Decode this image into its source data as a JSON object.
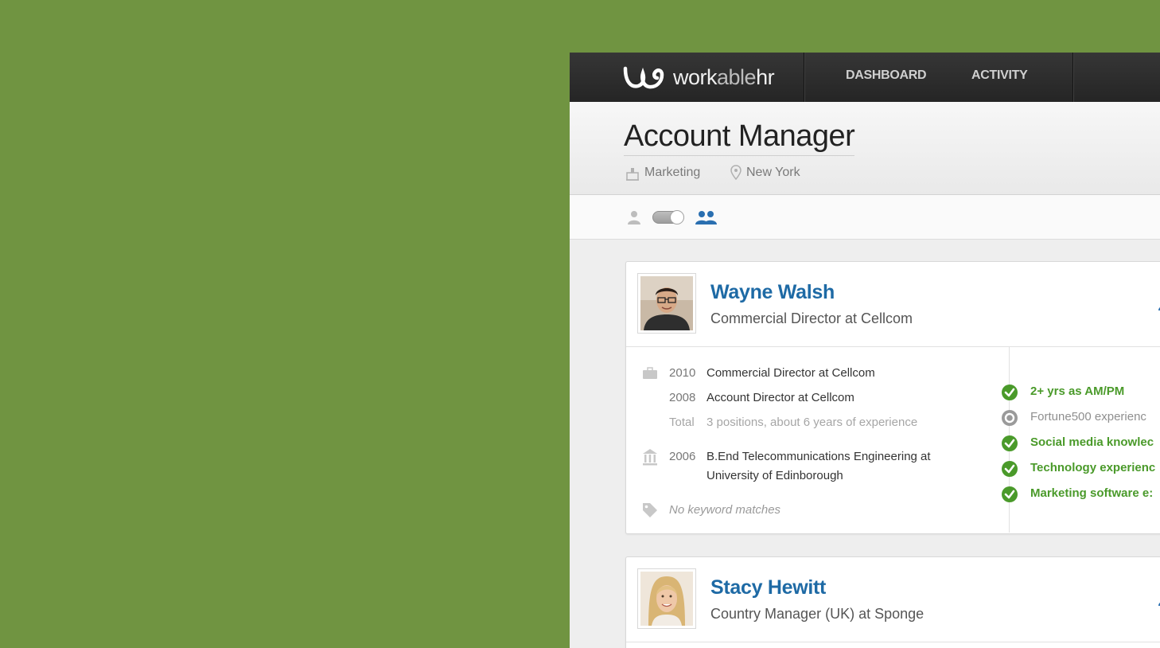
{
  "topbar": {
    "logo_main": "work",
    "logo_light": "able",
    "logo_end": "hr",
    "nav": [
      {
        "label": "DASHBOARD"
      },
      {
        "label": "ACTIVITY"
      }
    ]
  },
  "job": {
    "title": "Account Manager",
    "department": "Marketing",
    "location": "New York"
  },
  "candidates": [
    {
      "name": "Wayne Walsh",
      "headline": "Commercial Director at Cellcom",
      "experience": [
        {
          "year": "2010",
          "text": "Commercial Director at Cellcom"
        },
        {
          "year": "2008",
          "text": "Account Director at Cellcom"
        }
      ],
      "total_label": "Total",
      "total_text": "3 positions, about 6 years of experience",
      "education": {
        "year": "2006",
        "line1": "B.End Telecommunications Engineering at",
        "line2": "University of Edinborough"
      },
      "keywords": "No keyword matches",
      "requirements": [
        {
          "label": "2+ yrs as AM/PM",
          "met": true
        },
        {
          "label": "Fortune500 experienc",
          "met": false
        },
        {
          "label": "Social media knowlec",
          "met": true
        },
        {
          "label": "Technology experienc",
          "met": true
        },
        {
          "label": "Marketing software e:",
          "met": true
        }
      ]
    },
    {
      "name": "Stacy Hewitt",
      "headline": "Country Manager (UK) at Sponge"
    }
  ],
  "colors": {
    "background": "#709441",
    "topbar": "#2b2b2b",
    "link": "#1e6aa5",
    "check": "#4a9a2a"
  }
}
